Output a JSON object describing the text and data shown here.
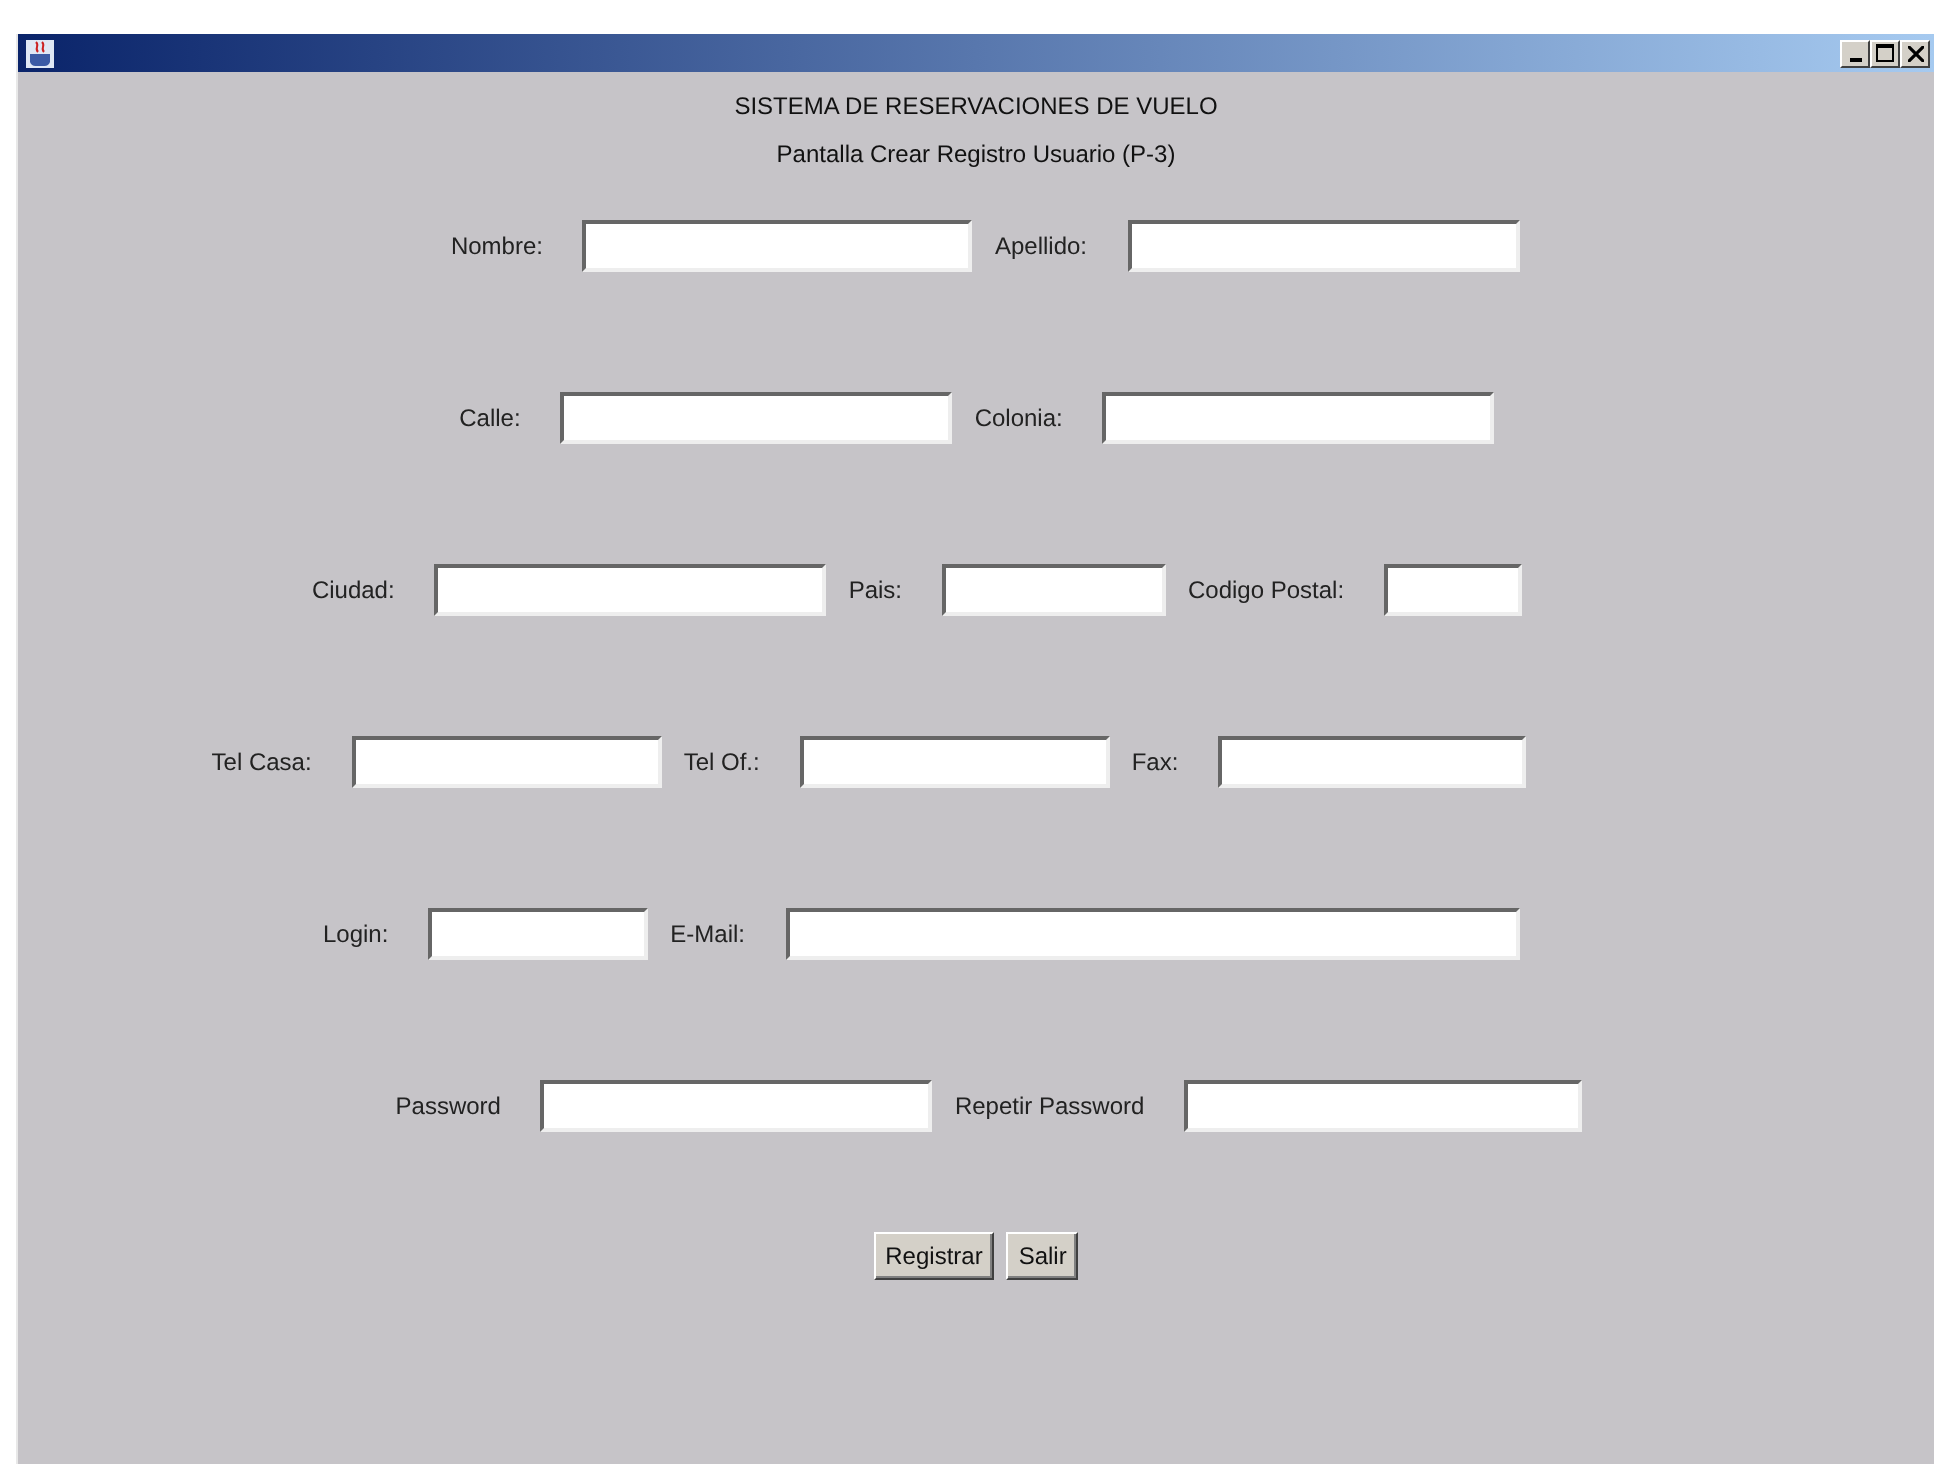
{
  "window": {
    "title": "SISTEMA DE RESERVACIONES DE VUELO",
    "subtitle": "Pantalla Crear Registro Usuario (P-3)"
  },
  "rows": [
    {
      "fields": [
        {
          "label": "Nombre:"
        },
        {
          "label": "Apellido:"
        }
      ]
    },
    {
      "fields": [
        {
          "label": "Calle:"
        },
        {
          "label": "Colonia:"
        }
      ]
    },
    {
      "fields": [
        {
          "label": "Ciudad:"
        },
        {
          "label": "Pais:"
        },
        {
          "label": "Codigo Postal:"
        }
      ]
    },
    {
      "fields": [
        {
          "label": "Tel Casa:"
        },
        {
          "label": "Tel Of.:"
        },
        {
          "label": "Fax:"
        }
      ]
    },
    {
      "fields": [
        {
          "label": "Login:"
        },
        {
          "label": "E-Mail:"
        }
      ]
    },
    {
      "fields": [
        {
          "label": "Password"
        },
        {
          "label": "Repetir Password"
        }
      ]
    }
  ],
  "buttons": [
    "Registrar",
    "Salir"
  ]
}
